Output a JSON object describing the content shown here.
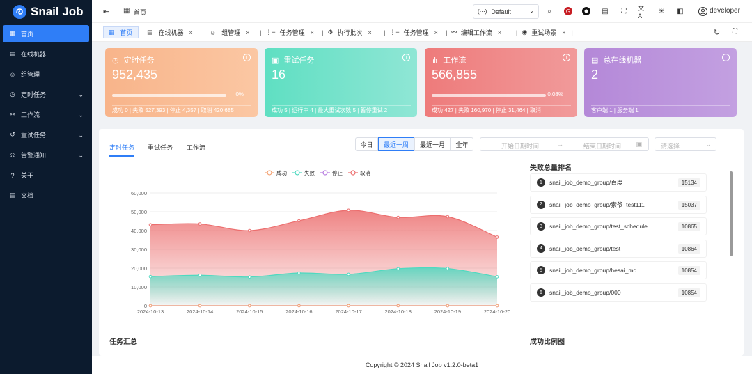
{
  "app": {
    "name": "Snail Job"
  },
  "sidebar": {
    "items": [
      {
        "label": "首页",
        "icon": "dashboard-icon",
        "active": true
      },
      {
        "label": "在线机器",
        "icon": "list-icon"
      },
      {
        "label": "组管理",
        "icon": "group-icon"
      },
      {
        "label": "定时任务",
        "icon": "clock-icon",
        "expandable": true
      },
      {
        "label": "工作流",
        "icon": "workflow-icon",
        "expandable": true
      },
      {
        "label": "重试任务",
        "icon": "retry-icon",
        "expandable": true
      },
      {
        "label": "告警通知",
        "icon": "bell-icon",
        "expandable": true
      },
      {
        "label": "关于",
        "icon": "question-icon"
      },
      {
        "label": "文档",
        "icon": "document-icon"
      }
    ]
  },
  "topbar": {
    "breadcrumb": "首页",
    "namespace": "Default",
    "user": "developer"
  },
  "tabs": [
    {
      "label": "首页",
      "active": true
    },
    {
      "label": "在线机器"
    },
    {
      "label": "组管理"
    },
    {
      "label": "任务管理"
    },
    {
      "label": "执行批次"
    },
    {
      "label": "任务管理"
    },
    {
      "label": "编辑工作流"
    },
    {
      "label": "重试场景"
    }
  ],
  "cards": [
    {
      "title": "定时任务",
      "value": "952,435",
      "progress_pct": 0,
      "progress_label": "0%",
      "footer": "成功 0 | 失败 527,393 | 停止 4,357 | 取消 420,685",
      "color_from": "#f9b98f",
      "color_to": "#fbc9a0"
    },
    {
      "title": "重试任务",
      "value": "16",
      "footer": "成功 5 | 运行中 4 | 最大重试次数 5 | 暂停重试 2",
      "color_from": "#5fe0c3",
      "color_to": "#8fe8d4"
    },
    {
      "title": "工作流",
      "value": "566,855",
      "progress_pct": 0.08,
      "progress_label": "0.08%",
      "footer": "成功 427 | 失败 160,970 | 停止 31,464 | 取消",
      "color_from": "#ef7d7d",
      "color_to": "#f19898"
    },
    {
      "title": "总在线机器",
      "value": "2",
      "footer": "客户端 1 | 服务端 1",
      "color_from": "#b58ad8",
      "color_to": "#c29ee0"
    }
  ],
  "panel": {
    "tabs": [
      "定时任务",
      "重试任务",
      "工作流"
    ],
    "active_tab": "定时任务",
    "range_buttons": [
      "今日",
      "最近一周",
      "最近一月",
      "全年"
    ],
    "active_range": "最近一周",
    "start_placeholder": "开始日期时间",
    "end_placeholder": "结束日期时间",
    "select_placeholder": "请选择",
    "rank_title": "失败总量排名",
    "summary_title": "任务汇总",
    "ratio_title": "成功比例图"
  },
  "ranking": [
    {
      "rank": "1",
      "name": "snail_job_demo_group/百度",
      "count": "15134"
    },
    {
      "rank": "2",
      "name": "snail_job_demo_group/索爷_test111",
      "count": "15037"
    },
    {
      "rank": "3",
      "name": "snail_job_demo_group/test_schedule",
      "count": "10865"
    },
    {
      "rank": "4",
      "name": "snail_job_demo_group/test",
      "count": "10864"
    },
    {
      "rank": "5",
      "name": "snail_job_demo_group/hesai_mc",
      "count": "10854"
    },
    {
      "rank": "6",
      "name": "snail_job_demo_group/000",
      "count": "10854"
    }
  ],
  "footer": {
    "copyright": "Copyright © 2024 Snail Job v1.2.0-beta1"
  },
  "chart_data": {
    "type": "area",
    "x": [
      "2024-10-13",
      "2024-10-14",
      "2024-10-15",
      "2024-10-16",
      "2024-10-17",
      "2024-10-18",
      "2024-10-19",
      "2024-10-20"
    ],
    "ylim": [
      0,
      60000
    ],
    "yticks": [
      "0",
      "10,000",
      "20,000",
      "30,000",
      "40,000",
      "50,000",
      "60,000"
    ],
    "legend_position": "top-center",
    "series": [
      {
        "name": "成功",
        "color": "#f4a374",
        "values": [
          0,
          0,
          0,
          0,
          0,
          0,
          0,
          0
        ]
      },
      {
        "name": "失败",
        "color": "#4fd9c0",
        "values": [
          15500,
          16200,
          15300,
          17400,
          16700,
          19700,
          19800,
          15400
        ]
      },
      {
        "name": "停止",
        "color": "#b67be0",
        "values": [
          0,
          0,
          0,
          0,
          0,
          0,
          0,
          0
        ]
      },
      {
        "name": "取消",
        "color": "#ec6e6e",
        "values": [
          43100,
          43500,
          40000,
          45200,
          50800,
          47000,
          47400,
          36500
        ]
      }
    ]
  }
}
